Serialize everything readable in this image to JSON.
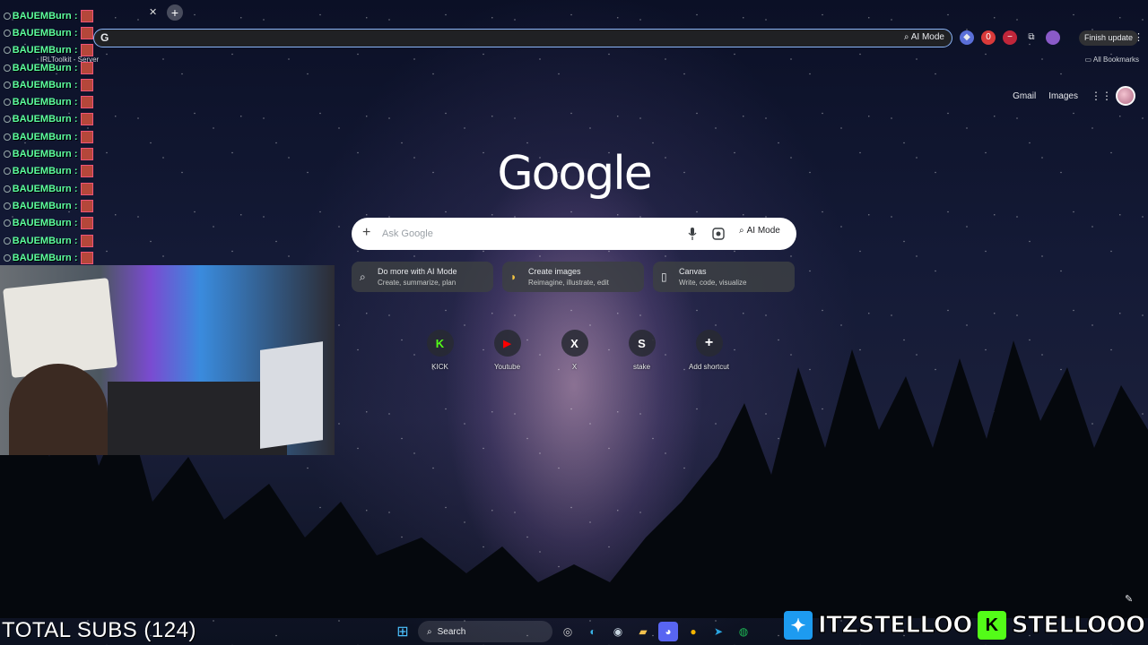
{
  "browser": {
    "omnibox_prefix": "G",
    "omnibox_ai_label": "AI Mode",
    "finish_update_label": "Finish update",
    "bookmark_item": "IRLToolkit - Server",
    "all_bookmarks": "All Bookmarks"
  },
  "chat": {
    "lines": [
      "BAUEMBurn :",
      "BAUEMBurn :",
      "BAUEMBurn :",
      "BAUEMBurn :",
      "BAUEMBurn :",
      "BAUEMBurn :",
      "BAUEMBurn :",
      "BAUEMBurn :",
      "BAUEMBurn :",
      "BAUEMBurn :",
      "BAUEMBurn :",
      "BAUEMBurn :",
      "BAUEMBurn :",
      "BAUEMBurn :",
      "BAUEMBurn :"
    ]
  },
  "google": {
    "logo": "Google",
    "gmail": "Gmail",
    "images": "Images",
    "search_placeholder": "Ask Google",
    "ai_mode": "AI Mode",
    "chips": [
      {
        "title": "Do more with AI Mode",
        "subtitle": "Create, summarize, plan",
        "icon": "search-sparkle-icon"
      },
      {
        "title": "Create images",
        "subtitle": "Reimagine, illustrate, edit",
        "icon": "banana-icon"
      },
      {
        "title": "Canvas",
        "subtitle": "Write, code, visualize",
        "icon": "canvas-icon"
      }
    ],
    "shortcuts": [
      {
        "label": "KICK",
        "glyph": "K",
        "color": "#53fc18"
      },
      {
        "label": "Youtube",
        "glyph": "▶",
        "color": "#ff0000"
      },
      {
        "label": "X",
        "glyph": "X",
        "color": "#ffffff"
      },
      {
        "label": "stake",
        "glyph": "S",
        "color": "#ffffff"
      },
      {
        "label": "Add shortcut",
        "glyph": "+",
        "color": "#ffffff"
      }
    ]
  },
  "overlay": {
    "total_subs": "TOTAL SUBS (124)",
    "twitter_handle": "ITZSTELLOO",
    "kick_handle": "STELLOOO"
  },
  "taskbar": {
    "search_label": "Search"
  },
  "colors": {
    "chat_name": "#5cff9d",
    "kick_green": "#53fc18",
    "twitter_blue": "#1d9bf0",
    "omnibox_focus": "#8ab4f8"
  }
}
